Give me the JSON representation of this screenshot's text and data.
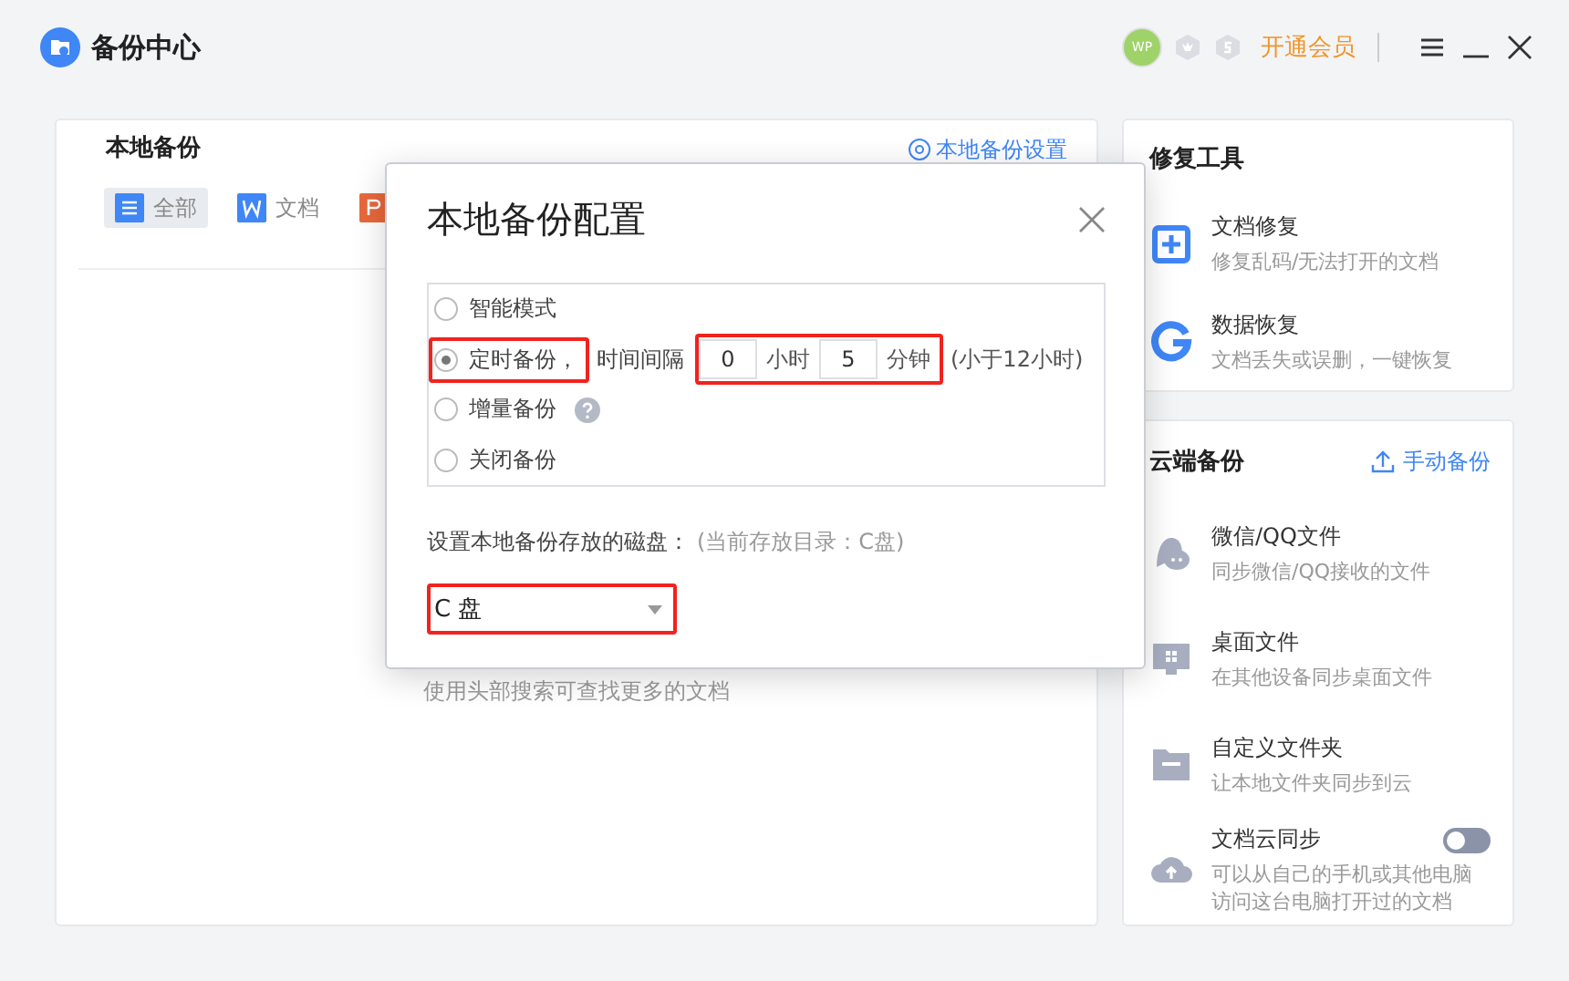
{
  "app": {
    "title": "备份中心",
    "avatar": "WP",
    "vip_link": "开通会员"
  },
  "local_backup": {
    "title": "本地备份",
    "settings_link": "本地备份设置",
    "tabs": [
      {
        "kind": "list",
        "label": "全部",
        "selected": true
      },
      {
        "kind": "word",
        "label": "文档",
        "selected": false
      },
      {
        "kind": "slides",
        "selected": false
      }
    ],
    "hint": "使用头部搜索可查找更多的文档"
  },
  "repair_tools": {
    "title": "修复工具",
    "items": [
      {
        "kind": "repair",
        "title": "文档修复",
        "subtitle": "修复乱码/无法打开的文档"
      },
      {
        "kind": "recover",
        "title": "数据恢复",
        "subtitle": "文档丢失或误删，一键恢复"
      }
    ]
  },
  "cloud_backup": {
    "title": "云端备份",
    "action": "手动备份",
    "items": [
      {
        "kind": "chat",
        "title": "微信/QQ文件",
        "subtitle": "同步微信/QQ接收的文件"
      },
      {
        "kind": "desktop",
        "title": "桌面文件",
        "subtitle": "在其他设备同步桌面文件"
      },
      {
        "kind": "folder",
        "title": "自定义文件夹",
        "subtitle": "让本地文件夹同步到云"
      },
      {
        "kind": "cloud",
        "title": "文档云同步",
        "subtitle": "可以从自己的手机或其他电脑访问这台电脑打开过的文档",
        "on": false
      }
    ]
  },
  "dialog": {
    "title": "本地备份配置",
    "options": [
      {
        "kind": "plain",
        "label": "智能模式",
        "selected": false,
        "highlighted": false
      },
      {
        "kind": "interval",
        "label": "定时备份，",
        "selected": true,
        "highlighted": true,
        "interval_label": "时间间隔",
        "hours": "0",
        "hours_unit": "小时",
        "minutes": "5",
        "minutes_unit": "分钟",
        "note": "(小于12小时)",
        "interval_highlighted": true
      },
      {
        "kind": "help",
        "label": "增量备份",
        "selected": false,
        "highlighted": false
      },
      {
        "kind": "plain",
        "label": "关闭备份",
        "selected": false,
        "highlighted": false
      }
    ],
    "disk_label": "设置本地备份存放的磁盘：",
    "disk_note": "(当前存放目录：C盘)",
    "disk": {
      "value": "C 盘",
      "highlighted": true
    }
  }
}
